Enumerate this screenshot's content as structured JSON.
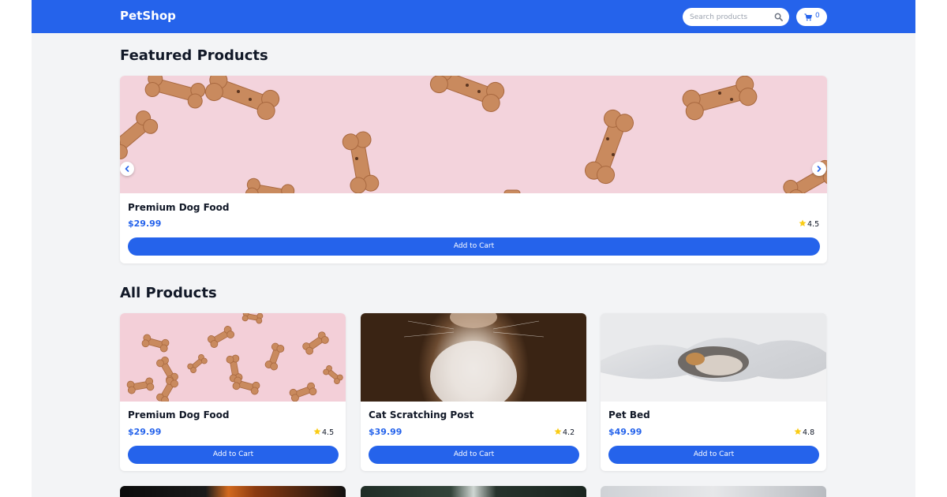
{
  "nav": {
    "brand": "PetShop",
    "search_placeholder": "Search products",
    "cart_count": "0"
  },
  "featured": {
    "title": "Featured Products",
    "product": {
      "name": "Premium Dog Food",
      "price": "$29.99",
      "rating": "4.5",
      "button": "Add to Cart"
    }
  },
  "all": {
    "title": "All Products",
    "products": [
      {
        "name": "Premium Dog Food",
        "price": "$29.99",
        "rating": "4.5",
        "button": "Add to Cart"
      },
      {
        "name": "Cat Scratching Post",
        "price": "$39.99",
        "rating": "4.2",
        "button": "Add to Cart"
      },
      {
        "name": "Pet Bed",
        "price": "$49.99",
        "rating": "4.8",
        "button": "Add to Cart"
      }
    ]
  },
  "colors": {
    "primary": "#2563eb",
    "star": "#facc15",
    "background": "#f3f4f6"
  },
  "icons": {
    "search": "search-icon",
    "cart": "shopping-cart-icon",
    "star": "star-icon",
    "prev": "chevron-left-icon",
    "next": "chevron-right-icon"
  }
}
